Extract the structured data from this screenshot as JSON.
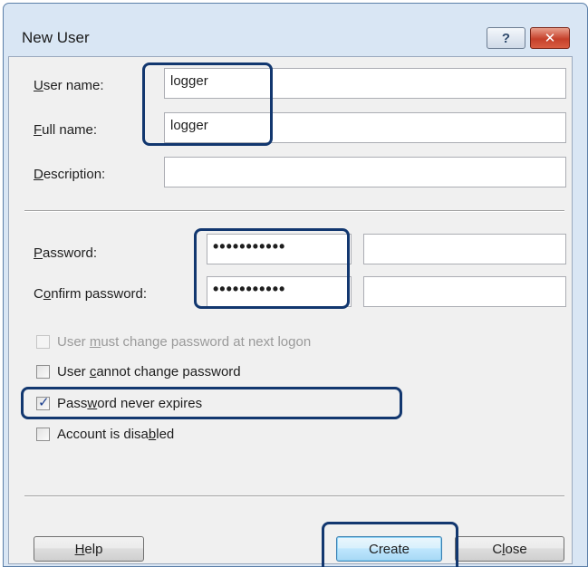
{
  "window": {
    "title": "New User",
    "help_glyph": "?",
    "close_glyph": "✕"
  },
  "form": {
    "username": {
      "label_mnemonic": "U",
      "label_rest": "ser name:",
      "value": "logger"
    },
    "fullname": {
      "label_mnemonic": "F",
      "label_rest": "ull name:",
      "value": "logger"
    },
    "description": {
      "label_mnemonic": "D",
      "label_rest": "escription:",
      "value": ""
    },
    "password": {
      "label_mnemonic": "P",
      "label_rest": "assword:",
      "value": "•••••••••••"
    },
    "confirm_password": {
      "label_pre": "C",
      "label_mnemonic": "o",
      "label_rest": "nfirm password:",
      "value": "•••••••••••"
    }
  },
  "options": [
    {
      "pre": "User ",
      "mnemonic": "m",
      "post": "ust change password at next logon",
      "checked": false,
      "disabled": true
    },
    {
      "pre": "User ",
      "mnemonic": "c",
      "post": "annot change password",
      "checked": false,
      "disabled": false
    },
    {
      "pre": "Pass",
      "mnemonic": "w",
      "post": "ord never expires",
      "checked": true,
      "disabled": false
    },
    {
      "pre": "Account is disa",
      "mnemonic": "b",
      "post": "led",
      "checked": false,
      "disabled": false
    }
  ],
  "buttons": {
    "help": {
      "mnemonic": "H",
      "rest": "elp"
    },
    "create": {
      "label": "Create"
    },
    "close": {
      "pre": "C",
      "mnemonic": "l",
      "rest": "ose"
    }
  },
  "colors": {
    "window_frame": "#d9e6f4",
    "dialog_face": "#f0f0f0",
    "highlight_border": "#12376f",
    "checkmark": "#1b3f8f"
  }
}
